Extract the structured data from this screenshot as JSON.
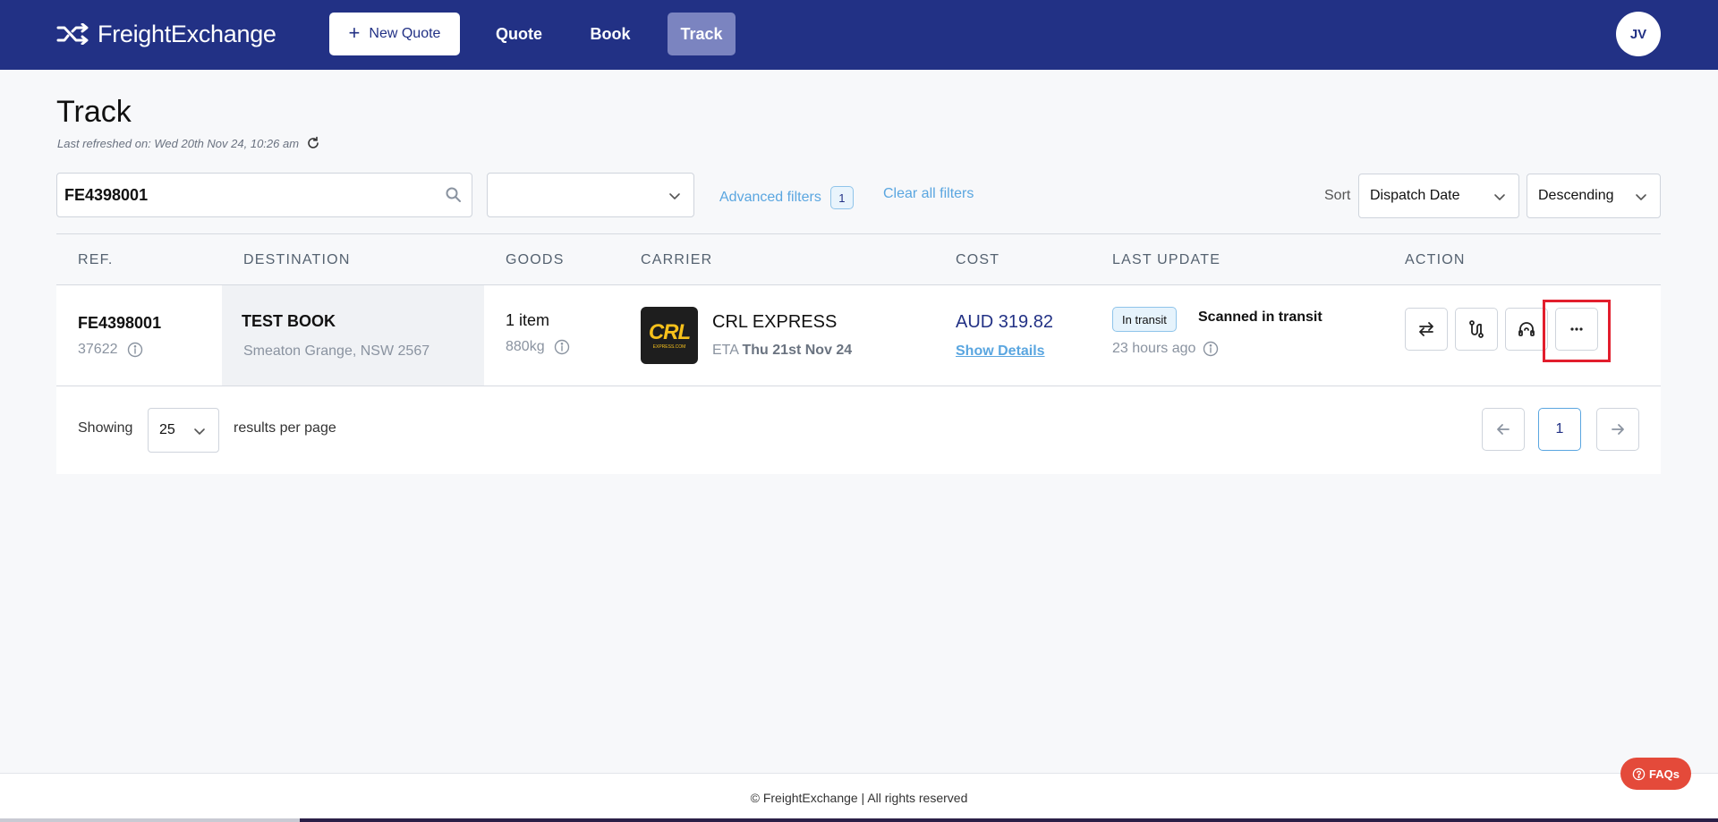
{
  "header": {
    "logo_text": "FreightExchange",
    "new_quote_label": "New Quote",
    "nav": [
      "Quote",
      "Book",
      "Track"
    ],
    "active_nav": "Track",
    "avatar_initials": "JV"
  },
  "page": {
    "title": "Track",
    "last_refreshed": "Last refreshed on: Wed 20th Nov 24, 10:26 am"
  },
  "filters": {
    "search_value": "FE4398001",
    "select_value": "",
    "advanced_filters_label": "Advanced filters",
    "advanced_filters_count": "1",
    "clear_all_label": "Clear all filters",
    "sort_label": "Sort",
    "sort_by": "Dispatch Date",
    "sort_direction": "Descending"
  },
  "table": {
    "columns": [
      "REF.",
      "DESTINATION",
      "GOODS",
      "CARRIER",
      "COST",
      "LAST UPDATE",
      "ACTION"
    ],
    "rows": [
      {
        "ref": "FE4398001",
        "ref_sub": "37622",
        "destination_name": "TEST BOOK",
        "destination_address": "Smeaton Grange, NSW 2567",
        "goods": "1 item",
        "weight": "880kg",
        "carrier_name": "CRL EXPRESS",
        "carrier_logo_text": "CRL",
        "carrier_logo_sub": "EXPRESS.COM",
        "eta_label": "ETA",
        "eta_date": "Thu 21st Nov 24",
        "cost": "AUD 319.82",
        "show_details": "Show Details",
        "status_badge": "In transit",
        "status_text": "Scanned in transit",
        "updated_ago": "23 hours ago"
      }
    ]
  },
  "pagination": {
    "showing_label": "Showing",
    "per_page": "25",
    "results_label": "results per page",
    "current_page": "1"
  },
  "footer": {
    "text": "© FreightExchange | All rights reserved",
    "faq_label": "FAQs"
  },
  "colors": {
    "header_bg": "#223185",
    "active_nav_bg": "#7b84c0",
    "link": "#5aa6e0",
    "highlight": "#e21e2d",
    "faq_bg": "#e44a3a"
  }
}
